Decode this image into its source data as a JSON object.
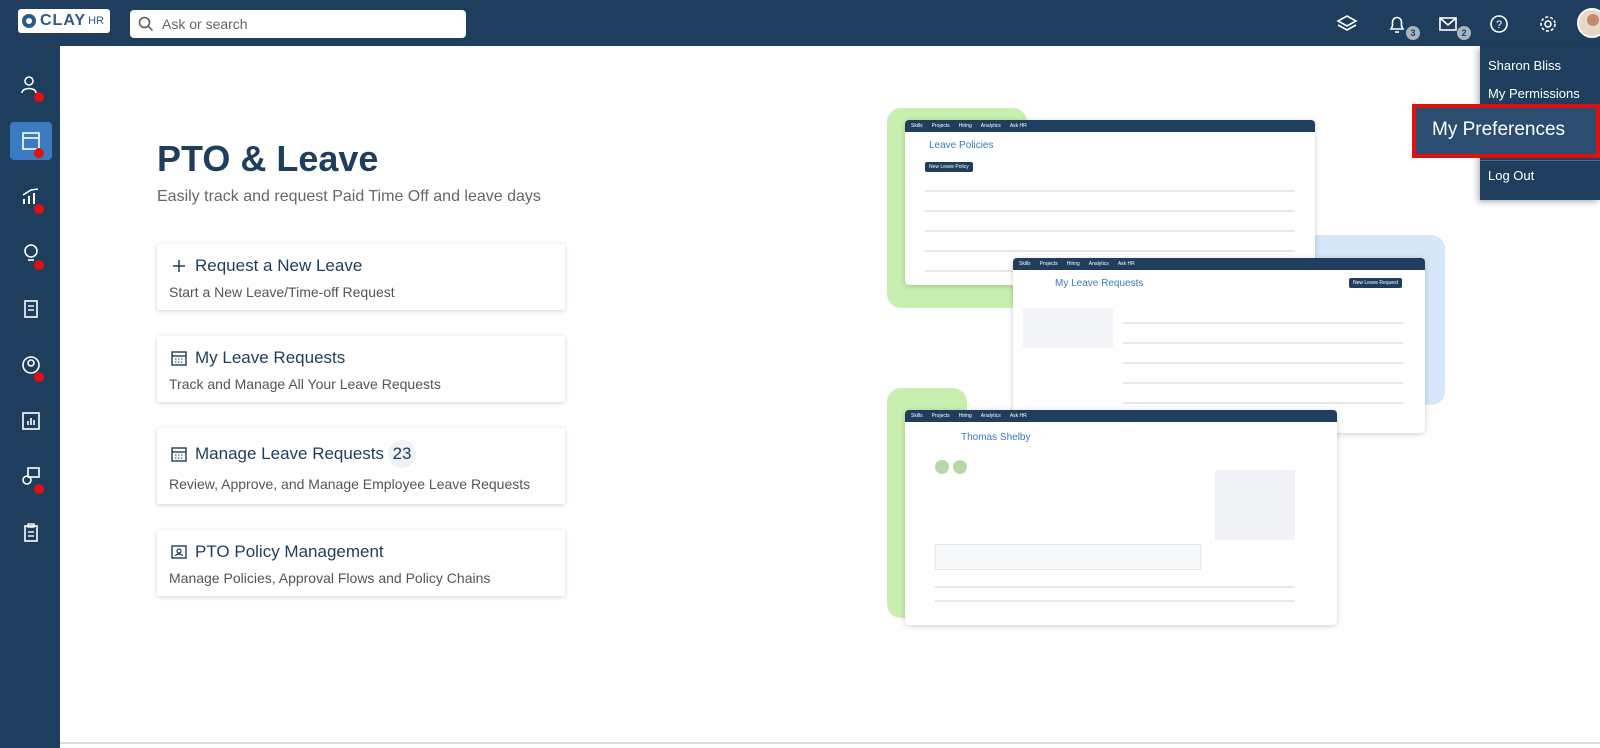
{
  "topbar": {
    "logo_text": "CLAY",
    "logo_suffix": "HR",
    "search_placeholder": "Ask or search",
    "notifications_count": "3",
    "messages_count": "2"
  },
  "user_menu": {
    "name": "Sharon Bliss",
    "permissions": "My Permissions",
    "preferences": "My Preferences",
    "logout": "Log Out"
  },
  "page": {
    "title": "PTO & Leave",
    "subtitle": "Easily track and request Paid Time Off and leave days"
  },
  "cards": [
    {
      "title": "Request a New Leave",
      "desc": "Start a New Leave/Time-off Request"
    },
    {
      "title": "My Leave Requests",
      "desc": "Track and Manage All Your Leave Requests"
    },
    {
      "title": "Manage Leave Requests",
      "count": "23",
      "desc": "Review, Approve, and Manage Employee Leave Requests"
    },
    {
      "title": "PTO Policy Management",
      "desc": "Manage Policies, Approval Flows and Policy Chains"
    }
  ],
  "illustration": {
    "shot1_title": "Leave Policies",
    "shot2_title": "My Leave Requests",
    "shot3_title": "Thomas Shelby",
    "nav": [
      "Skills",
      "Projects",
      "Hiring",
      "Analytics",
      "Ask HR"
    ],
    "new_policy": "New Leave Policy",
    "new_request": "New Leave Request"
  },
  "colors": {
    "navy": "#1f3d5c",
    "accent": "#3b7bbf",
    "highlight_border": "#e01010"
  }
}
